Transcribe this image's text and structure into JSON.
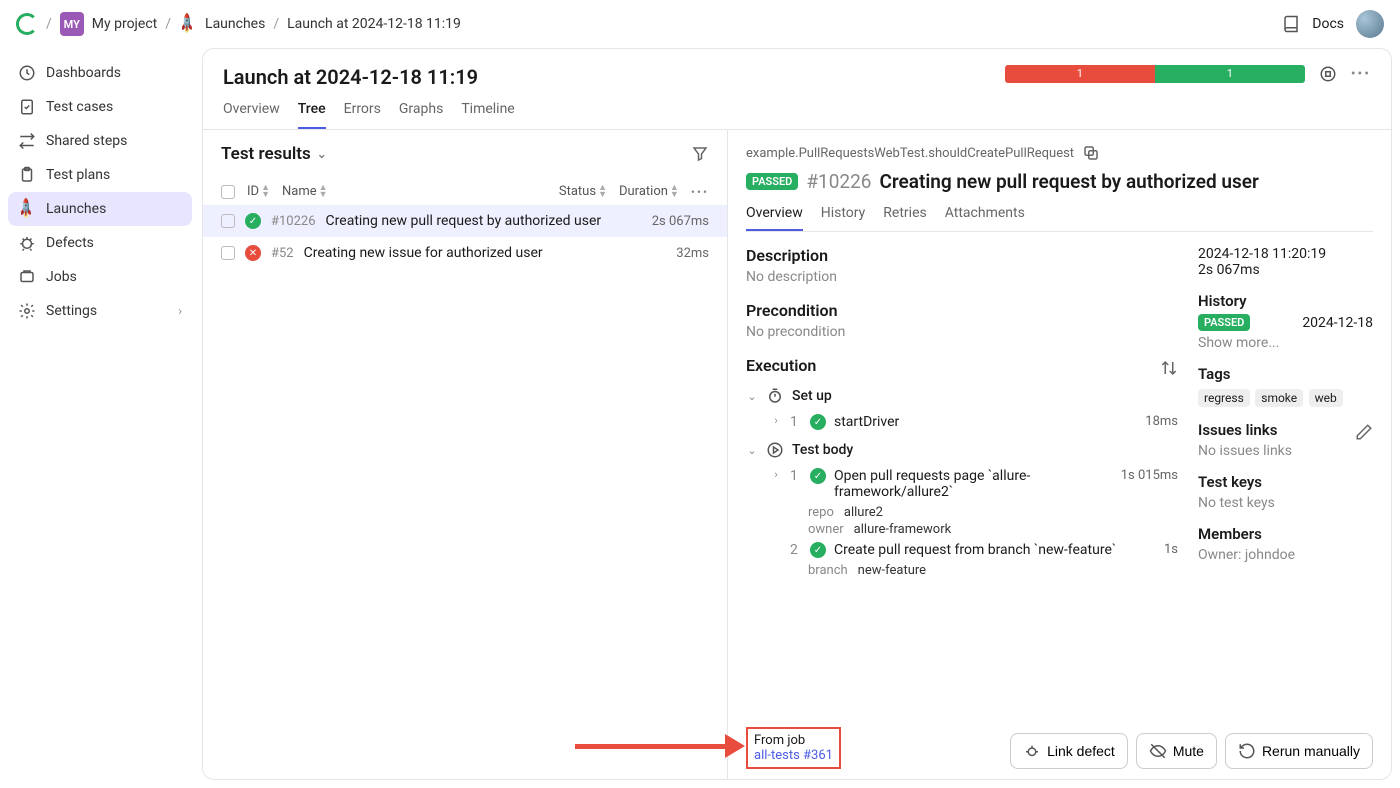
{
  "breadcrumb": {
    "project_badge": "MY",
    "project": "My project",
    "section": "Launches",
    "current": "Launch at 2024-12-18 11:19"
  },
  "top": {
    "docs": "Docs"
  },
  "sidebar": {
    "items": [
      {
        "label": "Dashboards"
      },
      {
        "label": "Test cases"
      },
      {
        "label": "Shared steps"
      },
      {
        "label": "Test plans"
      },
      {
        "label": "Launches"
      },
      {
        "label": "Defects"
      },
      {
        "label": "Jobs"
      },
      {
        "label": "Settings"
      }
    ]
  },
  "header": {
    "title": "Launch at 2024-12-18 11:19",
    "status": {
      "fail": "1",
      "pass": "1"
    }
  },
  "tabs": [
    "Overview",
    "Tree",
    "Errors",
    "Graphs",
    "Timeline"
  ],
  "results": {
    "title": "Test results",
    "cols": {
      "id": "ID",
      "name": "Name",
      "status": "Status",
      "duration": "Duration"
    },
    "rows": [
      {
        "status": "pass",
        "id": "#10226",
        "name": "Creating new pull request by authorized user",
        "duration": "2s 067ms"
      },
      {
        "status": "fail",
        "id": "#52",
        "name": "Creating new issue for authorized user",
        "duration": "32ms"
      }
    ]
  },
  "detail": {
    "path": "example.PullRequestsWebTest.shouldCreatePullRequest",
    "badge": "PASSED",
    "id": "#10226",
    "title": "Creating new pull request by authorized user",
    "tabs": [
      "Overview",
      "History",
      "Retries",
      "Attachments"
    ],
    "description": {
      "h": "Description",
      "v": "No description"
    },
    "precondition": {
      "h": "Precondition",
      "v": "No precondition"
    },
    "execution": {
      "h": "Execution"
    },
    "setup": {
      "h": "Set up"
    },
    "step1": {
      "num": "1",
      "name": "startDriver",
      "dur": "18ms"
    },
    "testbody": {
      "h": "Test body"
    },
    "step2": {
      "num": "1",
      "name": "Open pull requests page `allure-framework/allure2`",
      "dur": "1s 015ms"
    },
    "p_repo": {
      "k": "repo",
      "v": "allure2"
    },
    "p_owner": {
      "k": "owner",
      "v": "allure-framework"
    },
    "step3": {
      "num": "2",
      "name": "Create pull request from branch `new-feature`",
      "dur": "1s"
    },
    "p_branch": {
      "k": "branch",
      "v": "new-feature"
    },
    "side": {
      "ts": "2024-12-18 11:20:19",
      "dur": "2s 067ms",
      "history_h": "History",
      "hist_badge": "PASSED",
      "hist_date": "2024-12-18",
      "show_more": "Show more...",
      "tags_h": "Tags",
      "tags": [
        "regress",
        "smoke",
        "web"
      ],
      "issues_h": "Issues links",
      "issues_v": "No issues links",
      "keys_h": "Test keys",
      "keys_v": "No test keys",
      "members_h": "Members",
      "members_v": "Owner: johndoe"
    },
    "from_job": {
      "label": "From job",
      "link": "all-tests #361"
    },
    "btns": {
      "link": "Link defect",
      "mute": "Mute",
      "rerun": "Rerun manually"
    }
  }
}
